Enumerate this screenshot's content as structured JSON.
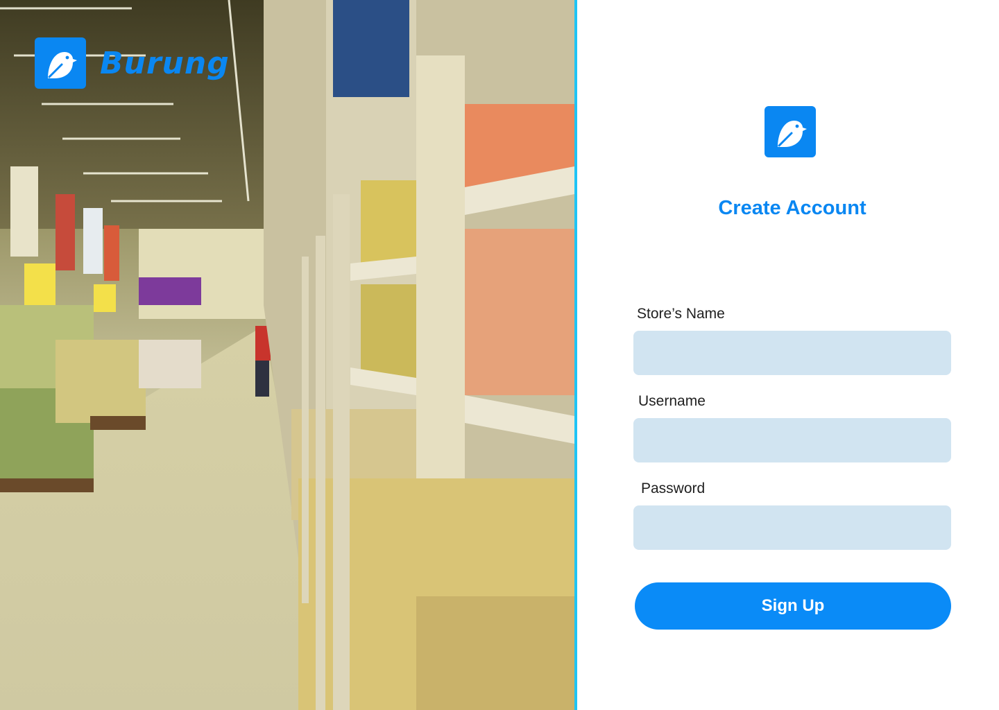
{
  "brand": {
    "name": "Burung",
    "logo_icon": "bird-icon",
    "color": "#0a87f2"
  },
  "hero": {
    "image": "supermarket-aisle-photo",
    "divider_color": "#1ec4f5"
  },
  "form": {
    "logo_icon": "bird-icon",
    "title": "Create Account",
    "fields": [
      {
        "label": "Store’s Name",
        "value": "",
        "placeholder": ""
      },
      {
        "label": "Username",
        "value": "",
        "placeholder": ""
      },
      {
        "label": "Password",
        "value": "",
        "placeholder": ""
      }
    ],
    "submit_label": "Sign Up",
    "colors": {
      "input_bg": "#d1e4f1",
      "button_bg": "#0a8bf7",
      "title": "#0a87f2"
    }
  }
}
